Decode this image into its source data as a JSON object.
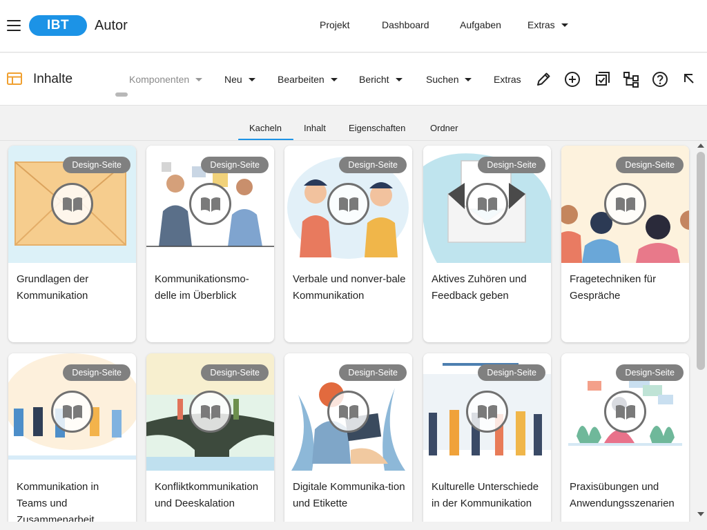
{
  "app": {
    "logo_text": "IBT",
    "name": "Autor"
  },
  "topnav": [
    {
      "label": "Projekt"
    },
    {
      "label": "Dashboard"
    },
    {
      "label": "Aufgaben"
    },
    {
      "label": "Extras"
    }
  ],
  "toolbar": {
    "section_title": "Inhalte",
    "menus": [
      {
        "label": "Komponenten",
        "disabled": true
      },
      {
        "label": "Neu"
      },
      {
        "label": "Bearbeiten"
      },
      {
        "label": "Bericht"
      },
      {
        "label": "Suchen"
      },
      {
        "label": "Extras"
      }
    ],
    "tools": [
      "pencil-icon",
      "add-circle-icon",
      "checklist-icon",
      "hierarchy-icon",
      "help-icon",
      "arrow-up-left-icon"
    ]
  },
  "tabs": [
    {
      "label": "Kacheln",
      "active": true
    },
    {
      "label": "Inhalt"
    },
    {
      "label": "Eigenschaften"
    },
    {
      "label": "Ordner"
    }
  ],
  "cards": [
    {
      "badge": "Design-Seite",
      "title": "Grundlagen der Kommunikation"
    },
    {
      "badge": "Design-Seite",
      "title": "Kommunikationsmo-delle im Überblick"
    },
    {
      "badge": "Design-Seite",
      "title": "Verbale und nonver-bale Kommunikation"
    },
    {
      "badge": "Design-Seite",
      "title": "Aktives Zuhören und Feedback geben"
    },
    {
      "badge": "Design-Seite",
      "title": "Fragetechniken für Gespräche"
    },
    {
      "badge": "Design-Seite",
      "title": "Kommunikation in Teams und Zusammenarbeit"
    },
    {
      "badge": "Design-Seite",
      "title": "Konfliktkommunikation und Deeskalation"
    },
    {
      "badge": "Design-Seite",
      "title": "Digitale Kommunika-tion und Etikette"
    },
    {
      "badge": "Design-Seite",
      "title": "Kulturelle Unterschiede in der Kommunikation"
    },
    {
      "badge": "Design-Seite",
      "title": "Praxisübungen und Anwendungsszenarien"
    }
  ],
  "colors": {
    "brand": "#1c93e6",
    "badge": "#808080",
    "active_tab": "#1c93e6"
  }
}
